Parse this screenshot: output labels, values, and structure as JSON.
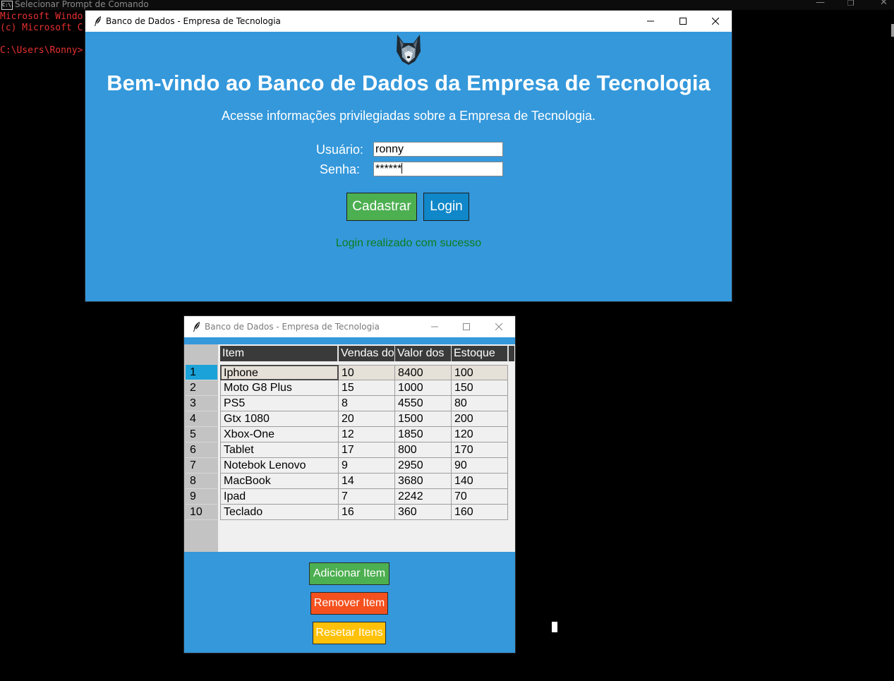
{
  "console": {
    "title": "Selecionar Prompt de Comando",
    "icon_text": "C:\\.",
    "lines": [
      "Microsoft Windo",
      "(c) Microsoft C",
      "",
      "C:\\Users\\Ronny>"
    ]
  },
  "login_window": {
    "title": "Banco de Dados - Empresa de Tecnologia",
    "heading": "Bem-vindo ao Banco de Dados da Empresa de Tecnologia",
    "subtitle": "Acesse informações privilegiadas sobre a Empresa de Tecnologia.",
    "username_label": "Usuário:",
    "username_value": "ronny",
    "password_label": "Senha:",
    "password_value": "******",
    "register_button": "Cadastrar",
    "login_button": "Login",
    "status_message": "Login realizado com sucesso",
    "colors": {
      "background": "#3498db",
      "register": "#4caf50",
      "login": "#1087c9",
      "status": "#0f7d1d"
    }
  },
  "table_window": {
    "title": "Banco de Dados - Empresa de Tecnologia",
    "columns": [
      "Item",
      "Vendas do",
      "Valor dos",
      "Estoque"
    ],
    "rows": [
      {
        "idx": "1",
        "cells": [
          "Iphone",
          "10",
          "8400",
          "100"
        ]
      },
      {
        "idx": "2",
        "cells": [
          "Moto G8 Plus",
          "15",
          "1000",
          "150"
        ]
      },
      {
        "idx": "3",
        "cells": [
          "PS5",
          "8",
          "4550",
          "80"
        ]
      },
      {
        "idx": "4",
        "cells": [
          "Gtx 1080",
          "20",
          "1500",
          "200"
        ]
      },
      {
        "idx": "5",
        "cells": [
          "Xbox-One",
          "12",
          "1850",
          "120"
        ]
      },
      {
        "idx": "6",
        "cells": [
          "Tablet",
          "17",
          "800",
          "170"
        ]
      },
      {
        "idx": "7",
        "cells": [
          "Notebok Lenovo",
          "9",
          "2950",
          "90"
        ]
      },
      {
        "idx": "8",
        "cells": [
          "MacBook",
          "14",
          "3680",
          "140"
        ]
      },
      {
        "idx": "9",
        "cells": [
          "Ipad",
          "7",
          "2242",
          "70"
        ]
      },
      {
        "idx": "10",
        "cells": [
          "Teclado",
          "16",
          "360",
          "160"
        ]
      }
    ],
    "selected_row": "1",
    "add_button": "Adicionar Item",
    "remove_button": "Remover Item",
    "reset_button": "Resetar Itens",
    "colors": {
      "add": "#4caf50",
      "remove": "#f4511e",
      "reset": "#ffc107",
      "header": "#3a3a3a"
    }
  }
}
